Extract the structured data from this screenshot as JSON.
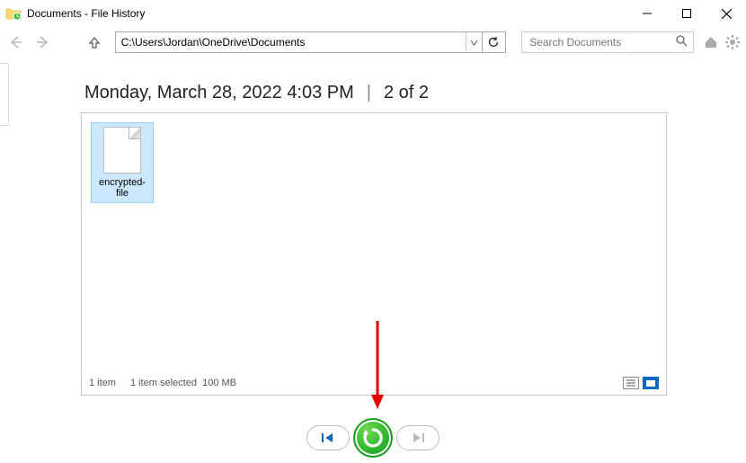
{
  "window": {
    "title": "Documents - File History"
  },
  "toolbar": {
    "address": "C:\\Users\\Jordan\\OneDrive\\Documents",
    "search_placeholder": "Search Documents"
  },
  "version_header": {
    "timestamp": "Monday, March 28, 2022 4:03 PM",
    "position": "2 of 2"
  },
  "files": [
    {
      "name": "encrypted-file"
    }
  ],
  "status": {
    "item_count": "1 item",
    "selection": "1 item selected",
    "size": "100 MB"
  }
}
